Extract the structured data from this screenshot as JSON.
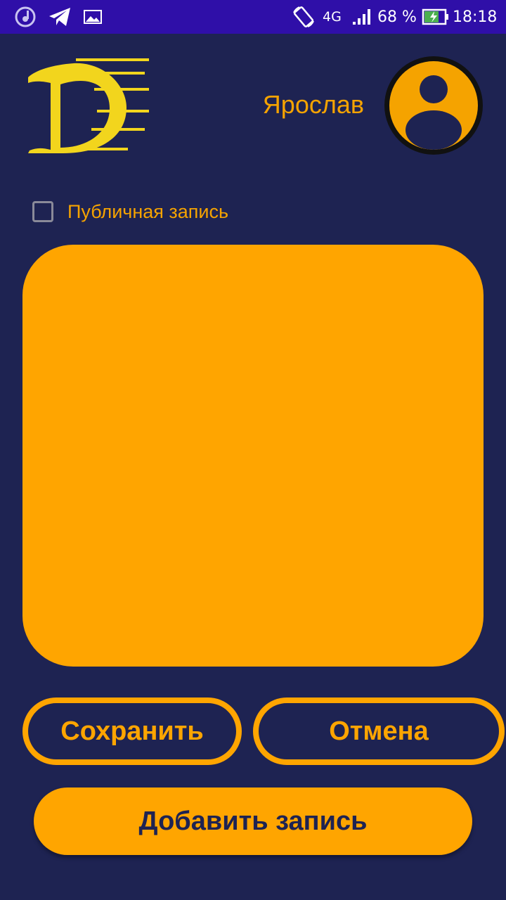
{
  "status_bar": {
    "network": "4G",
    "battery_percent": "68 %",
    "time": "18:18",
    "icons": [
      "music-sync-icon",
      "telegram-icon",
      "image-icon",
      "rotate-icon",
      "signal-icon",
      "battery-charging-icon"
    ]
  },
  "header": {
    "username": "Ярослав",
    "logo_icon": "d-logo-icon",
    "avatar_icon": "user-avatar-icon"
  },
  "form": {
    "public_label": "Публичная запись",
    "public_checked": false,
    "entry_text": ""
  },
  "actions": {
    "save_label": "Сохранить",
    "cancel_label": "Отмена",
    "add_label": "Добавить запись"
  },
  "colors": {
    "background": "#1e2352",
    "accent": "#ffa500",
    "status_bar": "#2f0fa8"
  }
}
